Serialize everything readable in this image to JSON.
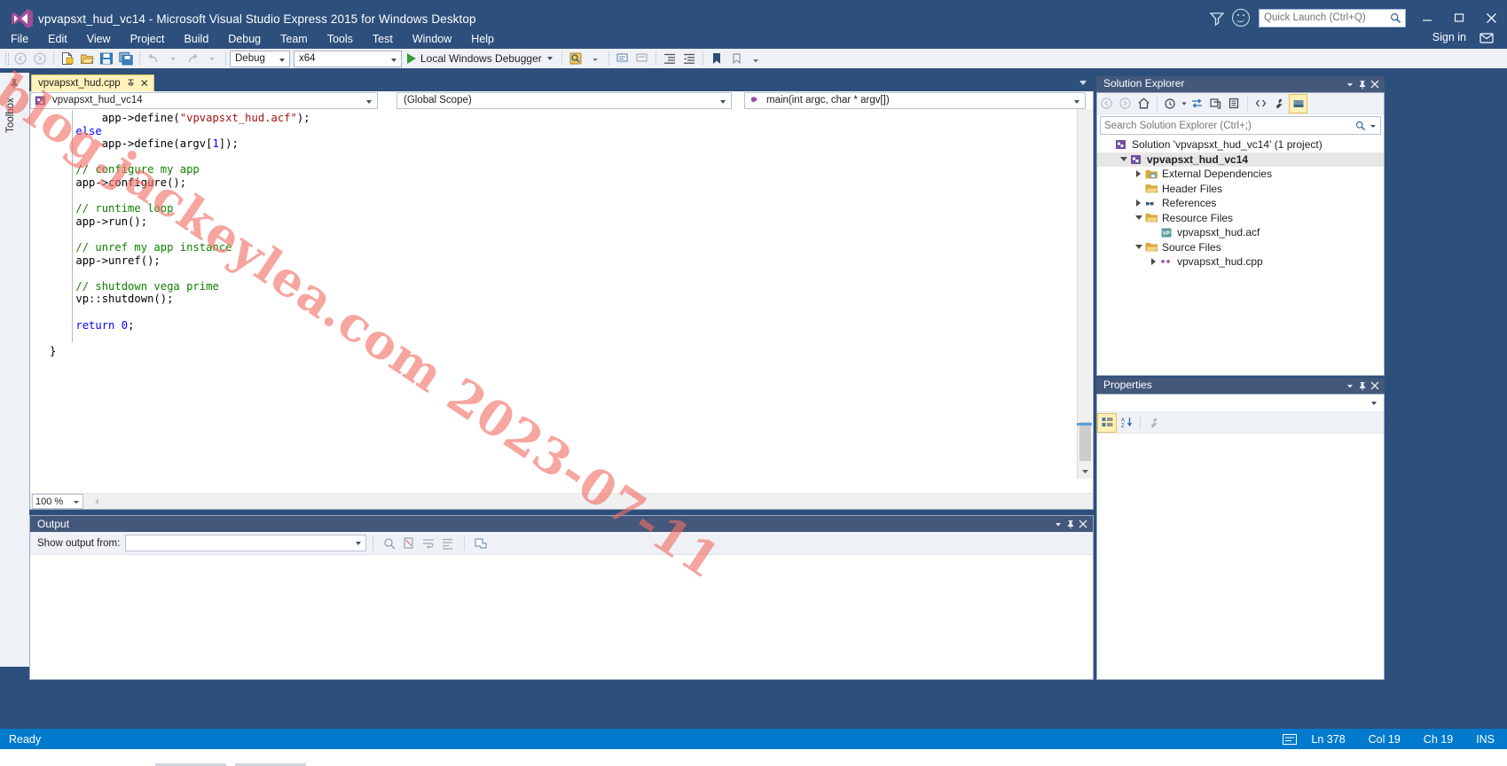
{
  "window": {
    "title": "vpvapsxt_hud_vc14 - Microsoft Visual Studio Express 2015 for Windows Desktop",
    "logo_icon": "visual-studio-logo",
    "minimize_icon": "minimize-icon",
    "maximize_icon": "maximize-icon",
    "close_icon": "close-icon",
    "feedback_icon": "smiley-feedback-icon",
    "filter_icon": "filter-icon",
    "signin_label": "Sign in",
    "signin_feedback_icon": "send-feedback-icon"
  },
  "quick_launch": {
    "placeholder": "Quick Launch (Ctrl+Q)",
    "value": "",
    "search_icon": "search-icon"
  },
  "menu": {
    "items": [
      {
        "label": "File"
      },
      {
        "label": "Edit"
      },
      {
        "label": "View"
      },
      {
        "label": "Project"
      },
      {
        "label": "Build"
      },
      {
        "label": "Debug"
      },
      {
        "label": "Team"
      },
      {
        "label": "Tools"
      },
      {
        "label": "Test"
      },
      {
        "label": "Window"
      },
      {
        "label": "Help"
      }
    ]
  },
  "toolbar": {
    "back_icon": "navigate-backward-icon",
    "forward_icon": "navigate-forward-icon",
    "new_item_icon": "new-item-icon",
    "open_file_icon": "open-file-icon",
    "save_icon": "save-icon",
    "save_all_icon": "save-all-icon",
    "undo_icon": "undo-icon",
    "redo_icon": "redo-icon",
    "configuration": "Debug",
    "platform": "x64",
    "start_debug_label": "Local Windows Debugger",
    "start_debug_icon": "play-icon",
    "find_icon": "find-icon",
    "step_icon": "step-into-icon",
    "comment_icon": "comment-selection-icon",
    "uncomment_icon": "uncomment-selection-icon",
    "indent_icon": "increase-indent-icon",
    "outdent_icon": "decrease-indent-icon",
    "bookmark_icon": "bookmark-icon",
    "bookmark_clear_icon": "clear-bookmarks-icon"
  },
  "toolbox": {
    "label": "Toolbox",
    "pin_icon": "auto-hide-pin-icon"
  },
  "editor": {
    "tab": {
      "name": "vpvapsxt_hud.cpp",
      "pin_icon": "pin-tab-icon",
      "close_icon": "close-tab-icon"
    },
    "tabstrip_menu_icon": "tab-list-dropdown-icon",
    "nav": {
      "project": "vpvapsxt_hud_vc14",
      "project_icon": "cpp-project-icon",
      "scope": "(Global Scope)",
      "function": "main(int argc, char * argv[])",
      "function_icon": "method-icon"
    },
    "zoom": "100 %",
    "scrollbar_up_icon": "scroll-up-icon",
    "scrollbar_down_icon": "scroll-down-icon",
    "splitter_icon": "split-view-icon",
    "code_lines": [
      {
        "indent": 8,
        "spans": [
          {
            "t": "app->define(",
            "c": ""
          },
          {
            "t": "\"vpvapsxt_hud.acf\"",
            "c": "str"
          },
          {
            "t": ");",
            "c": ""
          }
        ]
      },
      {
        "indent": 4,
        "spans": [
          {
            "t": "else",
            "c": "kw"
          }
        ]
      },
      {
        "indent": 8,
        "spans": [
          {
            "t": "app->define(argv[",
            "c": ""
          },
          {
            "t": "1",
            "c": "num"
          },
          {
            "t": "]);",
            "c": ""
          }
        ]
      },
      {
        "indent": 0,
        "spans": []
      },
      {
        "indent": 4,
        "spans": [
          {
            "t": "// configure my app",
            "c": "cm"
          }
        ]
      },
      {
        "indent": 4,
        "spans": [
          {
            "t": "app->configure();",
            "c": ""
          }
        ]
      },
      {
        "indent": 0,
        "spans": []
      },
      {
        "indent": 4,
        "spans": [
          {
            "t": "// runtime loop",
            "c": "cm"
          }
        ]
      },
      {
        "indent": 4,
        "spans": [
          {
            "t": "app->run();",
            "c": ""
          }
        ]
      },
      {
        "indent": 0,
        "spans": []
      },
      {
        "indent": 4,
        "spans": [
          {
            "t": "// unref my app instance",
            "c": "cm"
          }
        ]
      },
      {
        "indent": 4,
        "spans": [
          {
            "t": "app->unref();",
            "c": ""
          }
        ]
      },
      {
        "indent": 0,
        "spans": []
      },
      {
        "indent": 4,
        "spans": [
          {
            "t": "// shutdown vega prime",
            "c": "cm"
          }
        ]
      },
      {
        "indent": 4,
        "spans": [
          {
            "t": "vp::shutdown();",
            "c": ""
          }
        ]
      },
      {
        "indent": 0,
        "spans": []
      },
      {
        "indent": 4,
        "spans": [
          {
            "t": "return",
            "c": "kw"
          },
          {
            "t": " ",
            "c": ""
          },
          {
            "t": "0",
            "c": "num"
          },
          {
            "t": ";",
            "c": ""
          }
        ]
      },
      {
        "indent": 0,
        "spans": []
      },
      {
        "indent": 0,
        "spans": [
          {
            "t": "}",
            "c": ""
          }
        ]
      }
    ]
  },
  "output": {
    "title": "Output",
    "minimize_icon": "window-minimize-icon",
    "pin_icon": "auto-hide-pin-icon",
    "close_icon": "close-icon",
    "show_output_from_label": "Show output from:",
    "source_value": "",
    "find_message_icon": "find-message-icon",
    "clear_all_icon": "clear-all-icon",
    "toggle_wordwrap_icon": "toggle-word-wrap-icon",
    "go_to_message_icon": "go-to-message-icon",
    "body_text": ""
  },
  "solution_explorer": {
    "title": "Solution Explorer",
    "dropdown_icon": "window-menu-icon",
    "pin_icon": "auto-hide-pin-icon",
    "close_icon": "close-icon",
    "toolbar": {
      "back_icon": "back-icon",
      "forward_icon": "forward-icon",
      "home_icon": "home-icon",
      "pending_changes_icon": "pending-changes-icon",
      "sync_icon": "sync-with-active-document-icon",
      "refresh_icon": "refresh-icon",
      "collapse_all_icon": "collapse-all-icon",
      "show_all_files_icon": "show-all-files-icon",
      "properties_icon": "properties-icon",
      "preview_icon": "preview-selected-items-icon"
    },
    "search": {
      "placeholder": "Search Solution Explorer (Ctrl+;)",
      "value": "",
      "search_icon": "search-icon",
      "dropdown_icon": "chevron-down-icon"
    },
    "tree": [
      {
        "level": 0,
        "expander": "none",
        "icon": "solution-icon",
        "label": "Solution 'vpvapsxt_hud_vc14' (1 project)",
        "bold": false,
        "selected": false
      },
      {
        "level": 1,
        "expander": "down",
        "icon": "cpp-project-icon",
        "label": "vpvapsxt_hud_vc14",
        "bold": true,
        "selected": true
      },
      {
        "level": 2,
        "expander": "right",
        "icon": "external-dependencies-icon",
        "label": "External Dependencies",
        "bold": false,
        "selected": false
      },
      {
        "level": 2,
        "expander": "none",
        "icon": "folder-icon",
        "label": "Header Files",
        "bold": false,
        "selected": false
      },
      {
        "level": 2,
        "expander": "right",
        "icon": "references-icon",
        "label": "References",
        "bold": false,
        "selected": false
      },
      {
        "level": 2,
        "expander": "down",
        "icon": "folder-icon",
        "label": "Resource Files",
        "bold": false,
        "selected": false
      },
      {
        "level": 3,
        "expander": "none",
        "icon": "vp-file-icon",
        "label": "vpvapsxt_hud.acf",
        "bold": false,
        "selected": false
      },
      {
        "level": 2,
        "expander": "down",
        "icon": "folder-icon",
        "label": "Source Files",
        "bold": false,
        "selected": false
      },
      {
        "level": 3,
        "expander": "right",
        "icon": "cpp-file-icon",
        "label": "vpvapsxt_hud.cpp",
        "bold": false,
        "selected": false
      }
    ]
  },
  "properties": {
    "title": "Properties",
    "dropdown_icon": "window-menu-icon",
    "pin_icon": "auto-hide-pin-icon",
    "close_icon": "close-icon",
    "object_selector_value": "",
    "categorized_icon": "categorized-view-icon",
    "alphabetical_icon": "alphabetical-sort-icon",
    "property_pages_icon": "property-pages-icon"
  },
  "statusbar": {
    "status": "Ready",
    "indicator_icon": "editor-status-icon",
    "line": "Ln 378",
    "column": "Col 19",
    "character": "Ch 19",
    "insert_mode": "INS"
  },
  "watermark": {
    "text": "blog.jackeylea.com 2023-07-11"
  },
  "colors": {
    "chrome": "#2d4f7c",
    "status_bar": "#007acc",
    "accent_tab": "#fff2ba",
    "comment": "#108000",
    "keyword": "#0000ff",
    "string": "#a31515"
  }
}
